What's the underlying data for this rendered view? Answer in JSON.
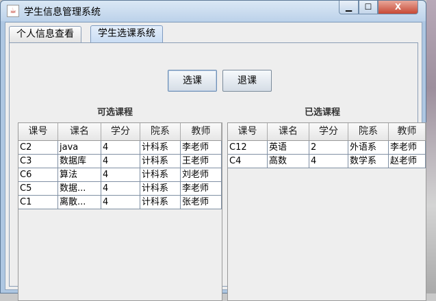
{
  "window": {
    "title": "学生信息管理系统",
    "min_label": "▁",
    "max_label": "☐",
    "close_label": "X",
    "icon_glyph": "☕"
  },
  "tabs": [
    {
      "label": "个人信息查看"
    },
    {
      "label": "学生选课系统"
    }
  ],
  "buttons": {
    "select": "选课",
    "drop": "退课"
  },
  "available": {
    "caption": "可选课程",
    "columns": [
      "课号",
      "课名",
      "学分",
      "院系",
      "教师"
    ],
    "rows": [
      [
        "C2",
        "java",
        "4",
        "计科系",
        "李老师"
      ],
      [
        "C3",
        "数据库",
        "4",
        "计科系",
        "王老师"
      ],
      [
        "C6",
        "算法",
        "4",
        "计科系",
        "刘老师"
      ],
      [
        "C5",
        "数据...",
        "4",
        "计科系",
        "李老师"
      ],
      [
        "C1",
        "离散...",
        "4",
        "计科系",
        "张老师"
      ]
    ]
  },
  "selected": {
    "caption": "已选课程",
    "columns": [
      "课号",
      "课名",
      "学分",
      "院系",
      "教师"
    ],
    "rows": [
      [
        "C12",
        "英语",
        "2",
        "外语系",
        "李老师"
      ],
      [
        "C4",
        "高数",
        "4",
        "数学系",
        "赵老师"
      ]
    ]
  }
}
